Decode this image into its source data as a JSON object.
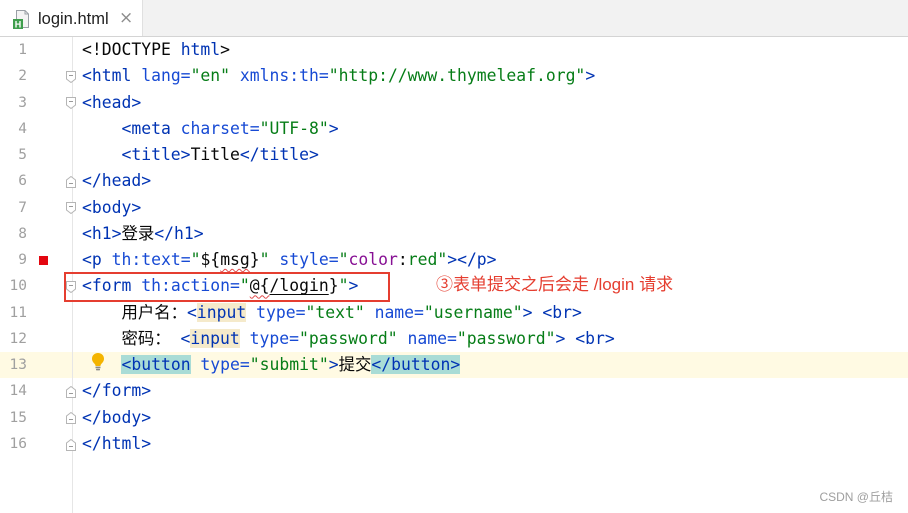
{
  "tab": {
    "filename": "login.html",
    "icon": "html-file-icon",
    "icon_badge": "H",
    "close_icon": "close-icon",
    "close_glyph": "×"
  },
  "colors": {
    "tag": "#0033b3",
    "attribute": "#174ad4",
    "value": "#067d17",
    "text": "#080808",
    "css_property": "#871094",
    "line_number": "#a0a0a0",
    "caret_row": "#fffae3",
    "tag_match": "#a9dcd6",
    "warning_bg": "#f5eacb",
    "annotation": "#e53e30",
    "unresolved_underline": "#e04b4b"
  },
  "lines": [
    {
      "num": "1",
      "tokens": [
        {
          "text": "<!DOCTYPE ",
          "color": "#080808"
        },
        {
          "text": "html",
          "color": "#0033b3"
        },
        {
          "text": ">",
          "color": "#080808"
        }
      ]
    },
    {
      "num": "2",
      "fold": "fold-start-icon",
      "tokens": [
        {
          "text": "<html",
          "color": "#0033b3"
        },
        {
          "text": " lang=",
          "color": "#174ad4"
        },
        {
          "text": "\"en\"",
          "color": "#067d17"
        },
        {
          "text": " xmlns:th=",
          "color": "#174ad4"
        },
        {
          "text": "\"http://www.thymeleaf.org\"",
          "color": "#067d17"
        },
        {
          "text": ">",
          "color": "#0033b3"
        }
      ]
    },
    {
      "num": "3",
      "fold": "fold-start-icon",
      "tokens": [
        {
          "text": "<head>",
          "color": "#0033b3"
        }
      ]
    },
    {
      "num": "4",
      "tokens": [
        {
          "text": "    <meta",
          "color": "#0033b3"
        },
        {
          "text": " charset=",
          "color": "#174ad4"
        },
        {
          "text": "\"UTF-8\"",
          "color": "#067d17"
        },
        {
          "text": ">",
          "color": "#0033b3"
        }
      ]
    },
    {
      "num": "5",
      "tokens": [
        {
          "text": "    <title>",
          "color": "#0033b3"
        },
        {
          "text": "Title",
          "color": "#080808"
        },
        {
          "text": "</title>",
          "color": "#0033b3"
        }
      ]
    },
    {
      "num": "6",
      "fold": "fold-end-icon",
      "tokens": [
        {
          "text": "</head>",
          "color": "#0033b3"
        }
      ]
    },
    {
      "num": "7",
      "fold": "fold-start-icon",
      "tokens": [
        {
          "text": "<body>",
          "color": "#0033b3"
        }
      ]
    },
    {
      "num": "8",
      "tokens": [
        {
          "text": "<h1>",
          "color": "#0033b3"
        },
        {
          "text": "登录",
          "color": "#080808"
        },
        {
          "text": "</h1>",
          "color": "#0033b3"
        }
      ]
    },
    {
      "num": "9",
      "color_preview": "#e3060f",
      "tokens": [
        {
          "text": "<p",
          "color": "#0033b3"
        },
        {
          "text": " th:text=",
          "color": "#174ad4"
        },
        {
          "text": "\"",
          "color": "#067d17"
        },
        {
          "text": "${",
          "color": "#080808"
        },
        {
          "text": "msg",
          "color": "#080808",
          "underline": "#e04b4b",
          "wavy": true
        },
        {
          "text": "}",
          "color": "#080808"
        },
        {
          "text": "\"",
          "color": "#067d17"
        },
        {
          "text": " style=",
          "color": "#174ad4"
        },
        {
          "text": "\"",
          "color": "#067d17"
        },
        {
          "text": "color",
          "color": "#871094"
        },
        {
          "text": ":",
          "color": "#080808"
        },
        {
          "text": "red",
          "color": "#067d17"
        },
        {
          "text": "\"",
          "color": "#067d17"
        },
        {
          "text": "></p>",
          "color": "#0033b3"
        }
      ]
    },
    {
      "num": "10",
      "fold": "fold-start-icon",
      "tokens": [
        {
          "text": "<form",
          "color": "#0033b3"
        },
        {
          "text": " th:action=",
          "color": "#174ad4"
        },
        {
          "text": "\"",
          "color": "#067d17"
        },
        {
          "text": "@{",
          "color": "#080808",
          "underline": "#e04b4b",
          "wavy": true
        },
        {
          "text": "/login",
          "color": "#080808",
          "underline": "#080808"
        },
        {
          "text": "}",
          "color": "#080808"
        },
        {
          "text": "\"",
          "color": "#067d17"
        },
        {
          "text": ">",
          "color": "#0033b3"
        }
      ]
    },
    {
      "num": "11",
      "tokens": [
        {
          "text": "    用户名：",
          "color": "#080808"
        },
        {
          "text": "<",
          "color": "#0033b3"
        },
        {
          "text": "input",
          "color": "#0033b3",
          "bg": "#f5eacb"
        },
        {
          "text": " type=",
          "color": "#174ad4"
        },
        {
          "text": "\"text\"",
          "color": "#067d17"
        },
        {
          "text": " name=",
          "color": "#174ad4"
        },
        {
          "text": "\"username\"",
          "color": "#067d17"
        },
        {
          "text": ">",
          "color": "#0033b3"
        },
        {
          "text": " <br>",
          "color": "#0033b3"
        }
      ]
    },
    {
      "num": "12",
      "tokens": [
        {
          "text": "    密码： ",
          "color": "#080808"
        },
        {
          "text": "<",
          "color": "#0033b3"
        },
        {
          "text": "input",
          "color": "#0033b3",
          "bg": "#f5eacb"
        },
        {
          "text": " type=",
          "color": "#174ad4"
        },
        {
          "text": "\"password\"",
          "color": "#067d17"
        },
        {
          "text": " name=",
          "color": "#174ad4"
        },
        {
          "text": "\"password\"",
          "color": "#067d17"
        },
        {
          "text": ">",
          "color": "#0033b3"
        },
        {
          "text": " <br>",
          "color": "#0033b3"
        }
      ]
    },
    {
      "num": "13",
      "caret": true,
      "gutter_icon": "lightbulb-icon",
      "tokens": [
        {
          "text": "    ",
          "color": "#080808"
        },
        {
          "text": "<button",
          "color": "#0033b3",
          "bg": "#a9dcd6"
        },
        {
          "text": " type=",
          "color": "#174ad4"
        },
        {
          "text": "\"submit\"",
          "color": "#067d17"
        },
        {
          "text": ">",
          "color": "#0033b3"
        },
        {
          "text": "提交",
          "color": "#080808"
        },
        {
          "text": "</button>",
          "color": "#0033b3",
          "bg": "#a9dcd6"
        }
      ]
    },
    {
      "num": "14",
      "fold": "fold-end-icon",
      "tokens": [
        {
          "text": "</form>",
          "color": "#0033b3"
        }
      ]
    },
    {
      "num": "15",
      "fold": "fold-end-icon",
      "tokens": [
        {
          "text": "</body>",
          "color": "#0033b3"
        }
      ]
    },
    {
      "num": "16",
      "fold": "fold-end-icon",
      "tokens": [
        {
          "text": "</html>",
          "color": "#0033b3"
        }
      ]
    }
  ],
  "annotation": {
    "text": "③表单提交之后会走 /login 请求"
  },
  "watermark": "CSDN @丘桔"
}
